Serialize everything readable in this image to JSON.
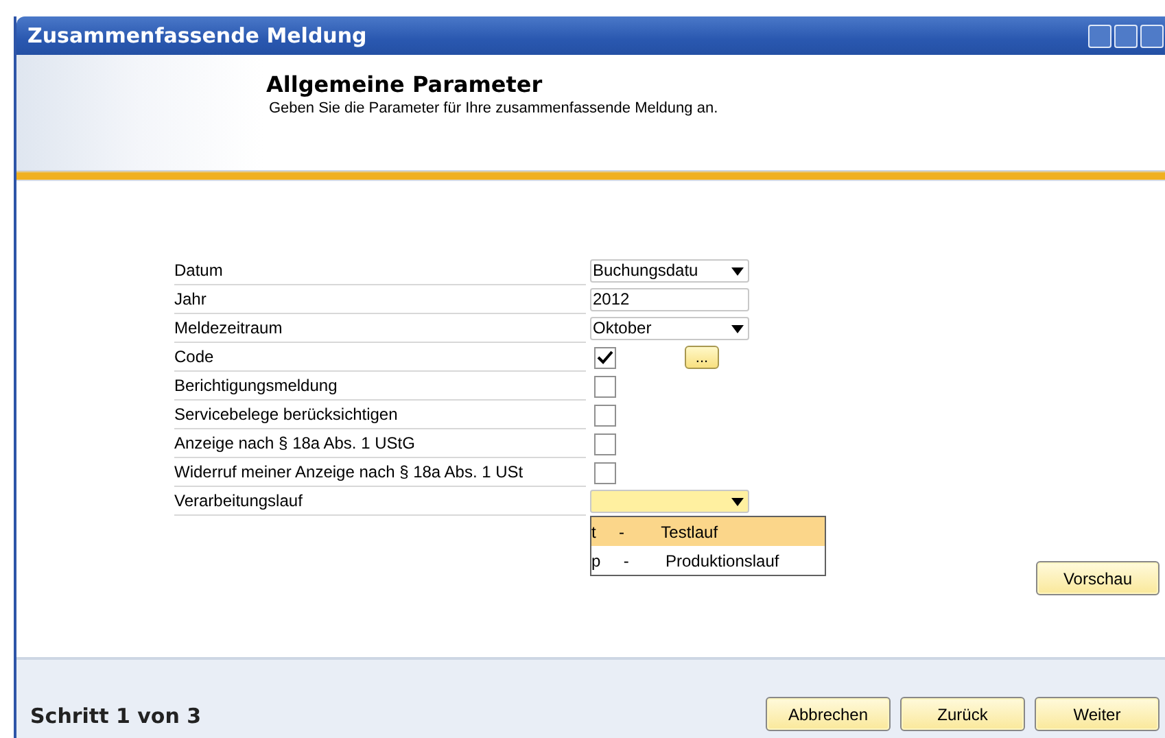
{
  "window": {
    "title": "Zusammenfassende Meldung"
  },
  "header": {
    "title": "Allgemeine Parameter",
    "subtitle": "Geben Sie die Parameter für Ihre zusammenfassende Meldung an."
  },
  "form": {
    "rows": [
      {
        "label": "Datum",
        "kind": "dropdown",
        "value": "Buchungsdatu"
      },
      {
        "label": "Jahr",
        "kind": "text",
        "value": "2012"
      },
      {
        "label": "Meldezeitraum",
        "kind": "dropdown",
        "value": "Oktober"
      },
      {
        "label": "Code",
        "kind": "checkbox",
        "checked": true,
        "button": "..."
      },
      {
        "label": "Berichtigungsmeldung",
        "kind": "checkbox",
        "checked": false
      },
      {
        "label": "Servicebelege berücksichtigen",
        "kind": "checkbox",
        "checked": false
      },
      {
        "label": "Anzeige nach § 18a Abs. 1 UStG",
        "kind": "checkbox",
        "checked": false
      },
      {
        "label": "Widerruf meiner Anzeige nach § 18a Abs. 1 USt",
        "kind": "checkbox",
        "checked": false
      },
      {
        "label": "Verarbeitungslauf",
        "kind": "dropdown",
        "value": "",
        "expanded": true,
        "options": [
          {
            "code": "t",
            "dash": "-",
            "name": "Testlauf",
            "selected": true
          },
          {
            "code": "p",
            "dash": "-",
            "name": "Produktionslauf",
            "selected": false
          }
        ]
      }
    ]
  },
  "preview_button": "Vorschau",
  "footer": {
    "step": "Schritt 1 von 3",
    "buttons": [
      "Abbrechen",
      "Zurück",
      "Weiter"
    ]
  }
}
